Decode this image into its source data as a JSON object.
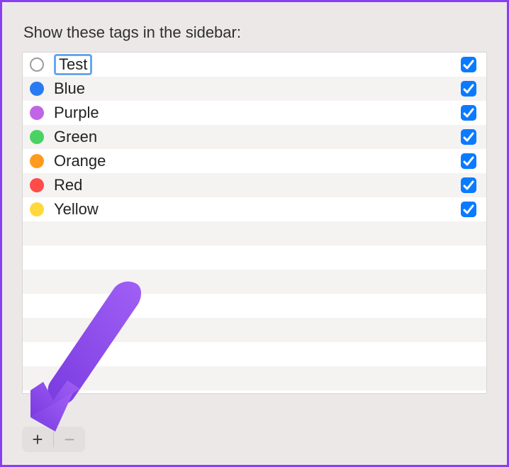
{
  "heading": "Show these tags in the sidebar:",
  "tags": [
    {
      "label": "Test",
      "color": "none",
      "checked": true,
      "editing": true
    },
    {
      "label": "Blue",
      "color": "#2a7af2",
      "checked": true
    },
    {
      "label": "Purple",
      "color": "#c065e6",
      "checked": true
    },
    {
      "label": "Green",
      "color": "#4bd264",
      "checked": true
    },
    {
      "label": "Orange",
      "color": "#ff9a1f",
      "checked": true
    },
    {
      "label": "Red",
      "color": "#ff4c4a",
      "checked": true
    },
    {
      "label": "Yellow",
      "color": "#ffd93b",
      "checked": true
    }
  ],
  "toolbar": {
    "add": "+",
    "remove": "−"
  }
}
